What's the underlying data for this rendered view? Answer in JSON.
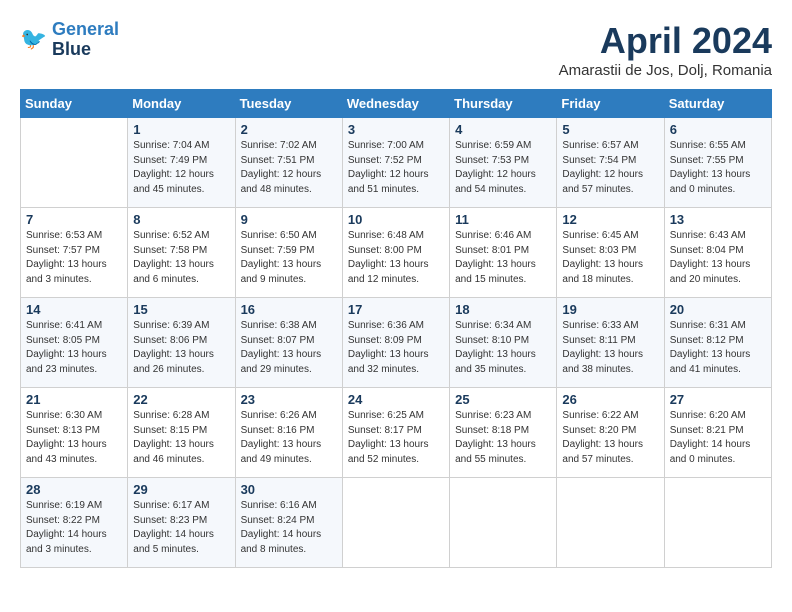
{
  "logo": {
    "line1": "General",
    "line2": "Blue"
  },
  "title": "April 2024",
  "subtitle": "Amarastii de Jos, Dolj, Romania",
  "days_header": [
    "Sunday",
    "Monday",
    "Tuesday",
    "Wednesday",
    "Thursday",
    "Friday",
    "Saturday"
  ],
  "weeks": [
    [
      {
        "day": "",
        "info": ""
      },
      {
        "day": "1",
        "info": "Sunrise: 7:04 AM\nSunset: 7:49 PM\nDaylight: 12 hours\nand 45 minutes."
      },
      {
        "day": "2",
        "info": "Sunrise: 7:02 AM\nSunset: 7:51 PM\nDaylight: 12 hours\nand 48 minutes."
      },
      {
        "day": "3",
        "info": "Sunrise: 7:00 AM\nSunset: 7:52 PM\nDaylight: 12 hours\nand 51 minutes."
      },
      {
        "day": "4",
        "info": "Sunrise: 6:59 AM\nSunset: 7:53 PM\nDaylight: 12 hours\nand 54 minutes."
      },
      {
        "day": "5",
        "info": "Sunrise: 6:57 AM\nSunset: 7:54 PM\nDaylight: 12 hours\nand 57 minutes."
      },
      {
        "day": "6",
        "info": "Sunrise: 6:55 AM\nSunset: 7:55 PM\nDaylight: 13 hours\nand 0 minutes."
      }
    ],
    [
      {
        "day": "7",
        "info": "Sunrise: 6:53 AM\nSunset: 7:57 PM\nDaylight: 13 hours\nand 3 minutes."
      },
      {
        "day": "8",
        "info": "Sunrise: 6:52 AM\nSunset: 7:58 PM\nDaylight: 13 hours\nand 6 minutes."
      },
      {
        "day": "9",
        "info": "Sunrise: 6:50 AM\nSunset: 7:59 PM\nDaylight: 13 hours\nand 9 minutes."
      },
      {
        "day": "10",
        "info": "Sunrise: 6:48 AM\nSunset: 8:00 PM\nDaylight: 13 hours\nand 12 minutes."
      },
      {
        "day": "11",
        "info": "Sunrise: 6:46 AM\nSunset: 8:01 PM\nDaylight: 13 hours\nand 15 minutes."
      },
      {
        "day": "12",
        "info": "Sunrise: 6:45 AM\nSunset: 8:03 PM\nDaylight: 13 hours\nand 18 minutes."
      },
      {
        "day": "13",
        "info": "Sunrise: 6:43 AM\nSunset: 8:04 PM\nDaylight: 13 hours\nand 20 minutes."
      }
    ],
    [
      {
        "day": "14",
        "info": "Sunrise: 6:41 AM\nSunset: 8:05 PM\nDaylight: 13 hours\nand 23 minutes."
      },
      {
        "day": "15",
        "info": "Sunrise: 6:39 AM\nSunset: 8:06 PM\nDaylight: 13 hours\nand 26 minutes."
      },
      {
        "day": "16",
        "info": "Sunrise: 6:38 AM\nSunset: 8:07 PM\nDaylight: 13 hours\nand 29 minutes."
      },
      {
        "day": "17",
        "info": "Sunrise: 6:36 AM\nSunset: 8:09 PM\nDaylight: 13 hours\nand 32 minutes."
      },
      {
        "day": "18",
        "info": "Sunrise: 6:34 AM\nSunset: 8:10 PM\nDaylight: 13 hours\nand 35 minutes."
      },
      {
        "day": "19",
        "info": "Sunrise: 6:33 AM\nSunset: 8:11 PM\nDaylight: 13 hours\nand 38 minutes."
      },
      {
        "day": "20",
        "info": "Sunrise: 6:31 AM\nSunset: 8:12 PM\nDaylight: 13 hours\nand 41 minutes."
      }
    ],
    [
      {
        "day": "21",
        "info": "Sunrise: 6:30 AM\nSunset: 8:13 PM\nDaylight: 13 hours\nand 43 minutes."
      },
      {
        "day": "22",
        "info": "Sunrise: 6:28 AM\nSunset: 8:15 PM\nDaylight: 13 hours\nand 46 minutes."
      },
      {
        "day": "23",
        "info": "Sunrise: 6:26 AM\nSunset: 8:16 PM\nDaylight: 13 hours\nand 49 minutes."
      },
      {
        "day": "24",
        "info": "Sunrise: 6:25 AM\nSunset: 8:17 PM\nDaylight: 13 hours\nand 52 minutes."
      },
      {
        "day": "25",
        "info": "Sunrise: 6:23 AM\nSunset: 8:18 PM\nDaylight: 13 hours\nand 55 minutes."
      },
      {
        "day": "26",
        "info": "Sunrise: 6:22 AM\nSunset: 8:20 PM\nDaylight: 13 hours\nand 57 minutes."
      },
      {
        "day": "27",
        "info": "Sunrise: 6:20 AM\nSunset: 8:21 PM\nDaylight: 14 hours\nand 0 minutes."
      }
    ],
    [
      {
        "day": "28",
        "info": "Sunrise: 6:19 AM\nSunset: 8:22 PM\nDaylight: 14 hours\nand 3 minutes."
      },
      {
        "day": "29",
        "info": "Sunrise: 6:17 AM\nSunset: 8:23 PM\nDaylight: 14 hours\nand 5 minutes."
      },
      {
        "day": "30",
        "info": "Sunrise: 6:16 AM\nSunset: 8:24 PM\nDaylight: 14 hours\nand 8 minutes."
      },
      {
        "day": "",
        "info": ""
      },
      {
        "day": "",
        "info": ""
      },
      {
        "day": "",
        "info": ""
      },
      {
        "day": "",
        "info": ""
      }
    ]
  ]
}
